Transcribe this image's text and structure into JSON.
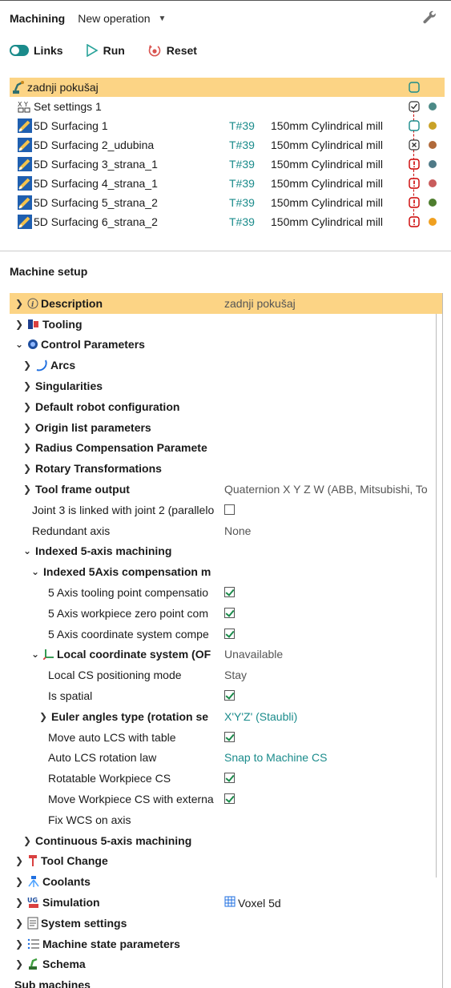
{
  "header": {
    "title": "Machining",
    "operation_select": "New operation"
  },
  "toolbar": {
    "links": "Links",
    "run": "Run",
    "reset": "Reset"
  },
  "operations": [
    {
      "name": "zadnji pokušaj",
      "tool_id": "",
      "tool": "",
      "status": "empty",
      "dot": "",
      "selected": true
    },
    {
      "name": "Set settings 1",
      "tool_id": "",
      "tool": "",
      "status": "check",
      "dot": "#4c8a87"
    },
    {
      "name": "5D Surfacing 1",
      "tool_id": "T#39",
      "tool": "150mm Cylindrical mill",
      "status": "empty-teal",
      "dot": "#c9a227"
    },
    {
      "name": "5D Surfacing 2_udubina",
      "tool_id": "T#39",
      "tool": "150mm Cylindrical mill",
      "status": "x",
      "dot": "#b0693a"
    },
    {
      "name": "5D Surfacing 3_strana_1",
      "tool_id": "T#39",
      "tool": "150mm Cylindrical mill",
      "status": "warn",
      "dot": "#4f7a87"
    },
    {
      "name": "5D Surfacing 4_strana_1",
      "tool_id": "T#39",
      "tool": "150mm Cylindrical mill",
      "status": "warn",
      "dot": "#c95c5c"
    },
    {
      "name": "5D Surfacing 5_strana_2",
      "tool_id": "T#39",
      "tool": "150mm Cylindrical mill",
      "status": "warn",
      "dot": "#4e7d2e"
    },
    {
      "name": "5D Surfacing 6_strana_2",
      "tool_id": "T#39",
      "tool": "150mm Cylindrical mill",
      "status": "warn",
      "dot": "#f0a020"
    }
  ],
  "setup": {
    "title": "Machine setup",
    "rows": [
      {
        "label": "Description",
        "value": "zadnji pokušaj"
      },
      {
        "label": "Tooling"
      },
      {
        "label": "Control Parameters"
      },
      {
        "label": "Arcs"
      },
      {
        "label": "Singularities"
      },
      {
        "label": "Default robot configuration"
      },
      {
        "label": "Origin list parameters"
      },
      {
        "label": "Radius Compensation Paramete"
      },
      {
        "label": "Rotary Transformations"
      },
      {
        "label": "Tool frame output",
        "value": "Quaternion X Y Z W (ABB, Mitsubishi, To"
      },
      {
        "label": "Joint 3 is linked with joint 2 (parallelo",
        "checked": false
      },
      {
        "label": "Redundant axis",
        "value": "None"
      },
      {
        "label": "Indexed 5-axis machining"
      },
      {
        "label": "Indexed 5Axis compensation m"
      },
      {
        "label": "5 Axis tooling point compensatio",
        "checked": true
      },
      {
        "label": "5 Axis workpiece zero point com",
        "checked": true
      },
      {
        "label": "5 Axis coordinate system compe",
        "checked": true
      },
      {
        "label": "Local coordinate system (OF",
        "value": "Unavailable"
      },
      {
        "label": "Local CS positioning mode",
        "value": "Stay"
      },
      {
        "label": "Is spatial",
        "checked": true
      },
      {
        "label": "Euler angles type (rotation se",
        "value": "X'Y'Z' (Staubli)"
      },
      {
        "label": "Move auto LCS with table",
        "checked": true
      },
      {
        "label": "Auto LCS rotation law",
        "value": "Snap to Machine CS"
      },
      {
        "label": "Rotatable Workpiece CS",
        "checked": true
      },
      {
        "label": "Move Workpiece CS with externa",
        "checked": true
      },
      {
        "label": "Fix WCS on axis"
      },
      {
        "label": "Continuous 5-axis machining"
      },
      {
        "label": "Tool Change"
      },
      {
        "label": "Coolants"
      },
      {
        "label": "Simulation",
        "value": "Voxel 5d"
      },
      {
        "label": "System settings"
      },
      {
        "label": "Machine state parameters"
      },
      {
        "label": "Schema"
      },
      {
        "label": "Sub machines"
      }
    ]
  }
}
